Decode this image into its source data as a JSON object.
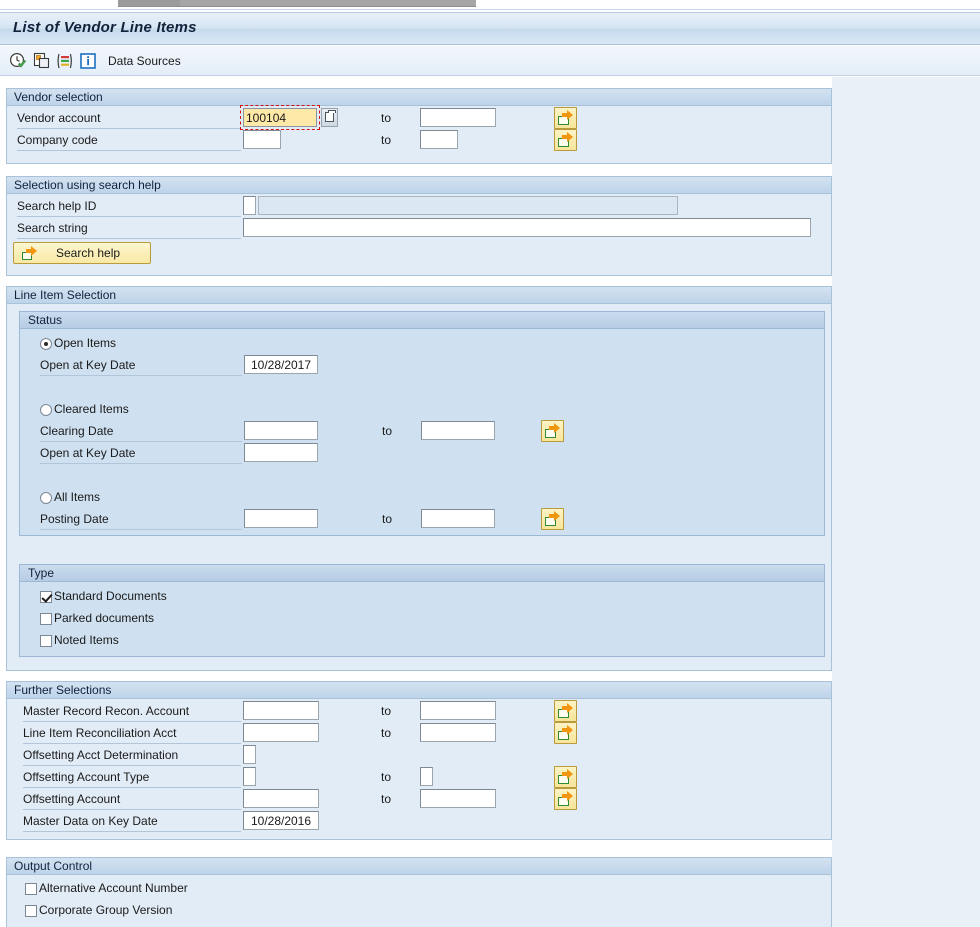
{
  "window": {
    "title": "List of Vendor Line Items"
  },
  "toolbar": {
    "icons": [
      {
        "name": "execute-icon"
      },
      {
        "name": "copy-icon"
      },
      {
        "name": "variants-icon"
      },
      {
        "name": "info-icon"
      }
    ],
    "data_sources_label": "Data Sources"
  },
  "vendor_selection": {
    "title": "Vendor selection",
    "rows": [
      {
        "label": "Vendor account",
        "from_value": "100104",
        "to_value": "",
        "focused": true,
        "has_matchcode": true,
        "has_multiselect": true
      },
      {
        "label": "Company code",
        "from_value": "",
        "to_value": "",
        "focused": false,
        "has_matchcode": false,
        "has_multiselect": true
      }
    ]
  },
  "search_help_section": {
    "title": "Selection using search help",
    "search_help_id_label": "Search help ID",
    "search_help_id_value": "",
    "search_help_desc_value": "",
    "search_string_label": "Search string",
    "search_string_value": "",
    "search_help_button": "Search help"
  },
  "line_item_selection": {
    "title": "Line Item Selection",
    "status": {
      "title": "Status",
      "open_items": {
        "label": "Open Items",
        "selected": true,
        "key_date_label": "Open at Key Date",
        "key_date_value": "10/28/2017"
      },
      "cleared_items": {
        "label": "Cleared Items",
        "selected": false,
        "clearing_date_label": "Clearing Date",
        "clearing_date_from": "",
        "clearing_date_to": "",
        "key_date_label": "Open at Key Date",
        "key_date_value": ""
      },
      "all_items": {
        "label": "All Items",
        "selected": false,
        "posting_date_label": "Posting Date",
        "posting_date_from": "",
        "posting_date_to": ""
      }
    },
    "type": {
      "title": "Type",
      "items": [
        {
          "label": "Standard Documents",
          "checked": true
        },
        {
          "label": "Parked documents",
          "checked": false
        },
        {
          "label": "Noted Items",
          "checked": false
        }
      ]
    }
  },
  "further_selections": {
    "title": "Further Selections",
    "rows": [
      {
        "label": "Master Record Recon. Account",
        "from_value": "",
        "to_value": "",
        "width": "wide",
        "has_to": true,
        "has_multiselect": true
      },
      {
        "label": "Line Item Reconciliation Acct",
        "from_value": "",
        "to_value": "",
        "width": "wide",
        "has_to": true,
        "has_multiselect": true
      },
      {
        "label": "Offsetting Acct Determination",
        "from_value": "",
        "to_value": "",
        "width": "tiny",
        "has_to": false,
        "has_multiselect": false
      },
      {
        "label": "Offsetting Account Type",
        "from_value": "",
        "to_value": "",
        "width": "tiny",
        "has_to": true,
        "has_multiselect": true
      },
      {
        "label": "Offsetting Account",
        "from_value": "",
        "to_value": "",
        "width": "wide",
        "has_to": true,
        "has_multiselect": true
      },
      {
        "label": "Master Data on Key Date",
        "from_value": "10/28/2016",
        "to_value": "",
        "width": "date",
        "has_to": false,
        "has_multiselect": false
      }
    ]
  },
  "output_control": {
    "title": "Output Control",
    "items": [
      {
        "label": "Alternative Account Number",
        "checked": false
      },
      {
        "label": "Corporate Group Version",
        "checked": false
      }
    ]
  },
  "common": {
    "to_label": "to"
  },
  "colors": {
    "panel_bg": "#e2ecf6",
    "subpanel_bg": "#cfe0f0",
    "header_blue": "#bed4e9",
    "focus_yellow": "#ffe9a8",
    "focus_outline": "#d01010",
    "button_yellow": "#f9e9a4",
    "page_bg": "#e9f0f8"
  }
}
